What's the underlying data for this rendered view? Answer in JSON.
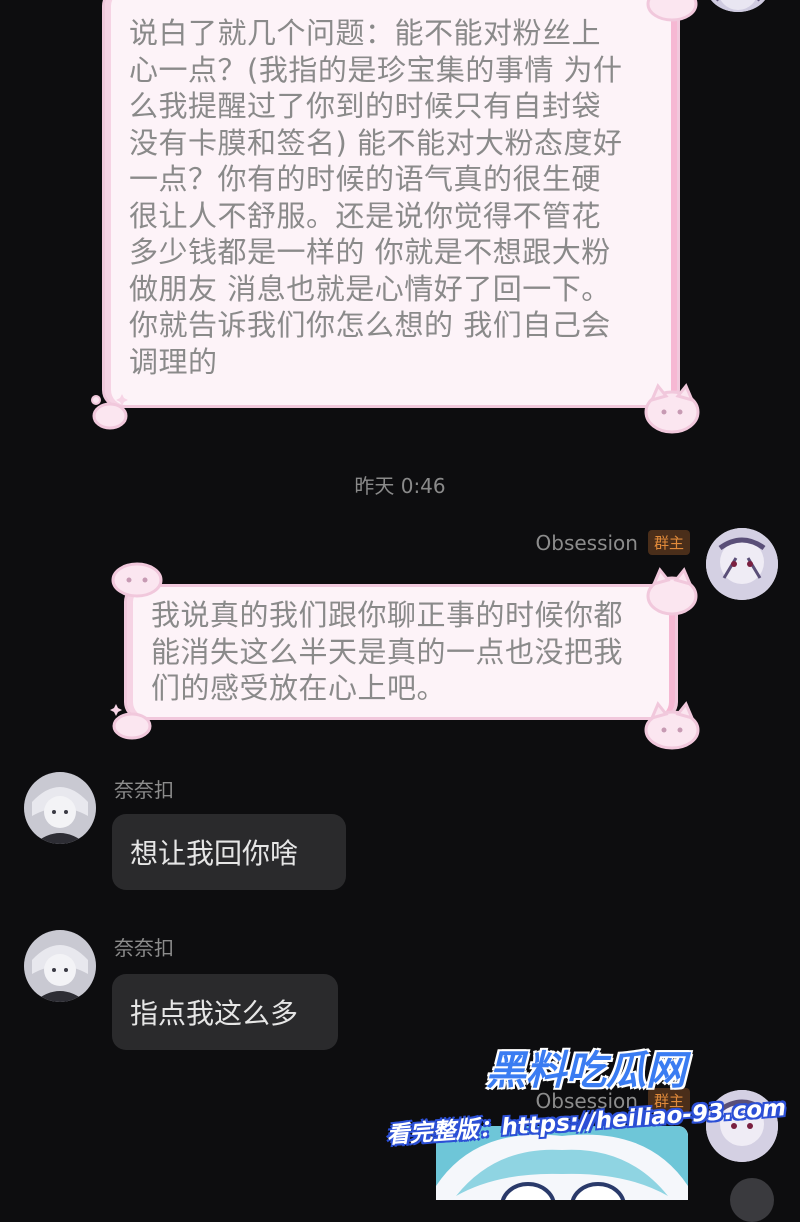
{
  "messages": [
    {
      "id": "m1",
      "text": "说白了就几个问题：能不能对粉丝上\n心一点？(我指的是珍宝集的事情 为什\n么我提醒过了你到的时候只有自封袋\n没有卡膜和签名) 能不能对大粉态度好\n一点？你有的时候的语气真的很生硬\n很让人不舒服。还是说你觉得不管花\n多少钱都是一样的 你就是不想跟大粉\n做朋友 消息也就是心情好了回一下。\n你就告诉我们你怎么想的 我们自己会\n调理的"
    },
    {
      "id": "m2",
      "sender": "Obsession",
      "badge": "群主",
      "text": "我说真的我们跟你聊正事的时候你都\n能消失这么半天是真的一点也没把我\n们的感受放在心上吧。"
    },
    {
      "id": "m3",
      "sender": "奈奈扣",
      "text": "想让我回你啥"
    },
    {
      "id": "m4",
      "sender": "奈奈扣",
      "text": "指点我这么多"
    },
    {
      "id": "m5",
      "sender": "Obsession",
      "badge": "群主"
    }
  ],
  "timestamp": "昨天 0:46",
  "watermark": {
    "title": "黑料吃瓜网",
    "url": "看完整版：https://heiliao-93.com"
  },
  "colors": {
    "background": "#0d0d0f",
    "pink_bubble_bg": "#fdf3f8",
    "pink_border": "#f1c8dc",
    "dark_bubble_bg": "#2a2a2c",
    "badge_text": "#e08a3a"
  }
}
